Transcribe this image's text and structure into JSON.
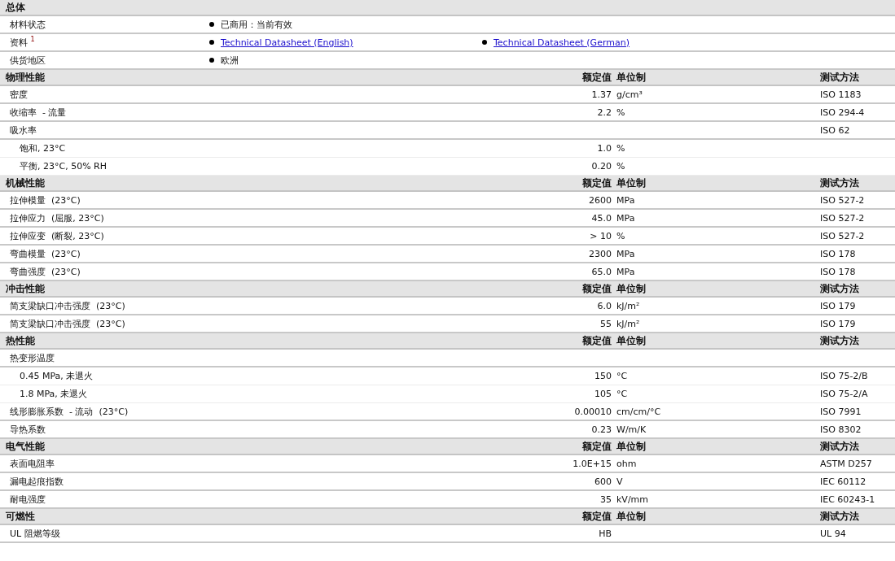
{
  "general": {
    "title": "总体",
    "rows": [
      {
        "label": "材料状态",
        "values": [
          {
            "text": "已商用：当前有效",
            "kind": "text"
          }
        ]
      },
      {
        "label": "资料 $^{1}$",
        "values": [
          {
            "text": "Technical Datasheet (English)",
            "kind": "link"
          },
          {
            "text": "Technical Datasheet (German)",
            "kind": "link"
          }
        ]
      },
      {
        "label": "供货地区",
        "values": [
          {
            "text": "欧洲",
            "kind": "text"
          }
        ]
      }
    ]
  },
  "sections": [
    {
      "title": "物理性能",
      "value_header": "额定值",
      "unit_header": "单位制",
      "method_header": "测试方法",
      "rows": [
        {
          "kind": "main",
          "label": "密度",
          "value": "1.37",
          "unit": "g/cm³",
          "method": "ISO 1183"
        },
        {
          "kind": "main",
          "label": "收缩率  - 流量",
          "value": "2.2",
          "unit": "%",
          "method": "ISO 294-4"
        },
        {
          "kind": "main",
          "label": "吸水率",
          "method": "ISO 62"
        },
        {
          "kind": "sub",
          "label": "饱和, 23°C",
          "value": "1.0",
          "unit": "%"
        },
        {
          "kind": "sub",
          "label": "平衡, 23°C, 50% RH",
          "value": "0.20",
          "unit": "%"
        }
      ]
    },
    {
      "title": "机械性能",
      "value_header": "额定值",
      "unit_header": "单位制",
      "method_header": "测试方法",
      "rows": [
        {
          "kind": "main",
          "label": "拉伸模量  (23°C)",
          "value": "2600",
          "unit": "MPa",
          "method": "ISO 527-2"
        },
        {
          "kind": "main",
          "label": "拉伸应力  (屈服, 23°C)",
          "value": "45.0",
          "unit": "MPa",
          "method": "ISO 527-2"
        },
        {
          "kind": "main",
          "label": "拉伸应变  (断裂, 23°C)",
          "value": "> 10",
          "unit": "%",
          "method": "ISO 527-2"
        },
        {
          "kind": "main",
          "label": "弯曲模量  (23°C)",
          "value": "2300",
          "unit": "MPa",
          "method": "ISO 178"
        },
        {
          "kind": "main",
          "label": "弯曲强度  (23°C)",
          "value": "65.0",
          "unit": "MPa",
          "method": "ISO 178"
        }
      ]
    },
    {
      "title": "冲击性能",
      "value_header": "额定值",
      "unit_header": "单位制",
      "method_header": "测试方法",
      "rows": [
        {
          "kind": "main",
          "label": "简支梁缺口冲击强度  (23°C)",
          "value": "6.0",
          "unit": "kJ/m²",
          "method": "ISO 179"
        },
        {
          "kind": "main",
          "label": "简支梁缺口冲击强度  (23°C)",
          "value": "55",
          "unit": "kJ/m²",
          "method": "ISO 179"
        }
      ]
    },
    {
      "title": "热性能",
      "value_header": "额定值",
      "unit_header": "单位制",
      "method_header": "测试方法",
      "rows": [
        {
          "kind": "main",
          "label": "热变形温度"
        },
        {
          "kind": "sub",
          "label": "0.45 MPa, 未退火",
          "value": "150",
          "unit": "°C",
          "method": "ISO 75-2/B"
        },
        {
          "kind": "sub",
          "label": "1.8 MPa, 未退火",
          "value": "105",
          "unit": "°C",
          "method": "ISO 75-2/A"
        },
        {
          "kind": "main",
          "label": "线形膨胀系数  - 流动  (23°C)",
          "value": "0.00010",
          "unit": "cm/cm/°C",
          "method": "ISO 7991"
        },
        {
          "kind": "main",
          "label": "导热系数",
          "value": "0.23",
          "unit": "W/m/K",
          "method": "ISO 8302"
        }
      ]
    },
    {
      "title": "电气性能",
      "value_header": "额定值",
      "unit_header": "单位制",
      "method_header": "测试方法",
      "rows": [
        {
          "kind": "main",
          "label": "表面电阻率",
          "value": "1.0E+15",
          "unit": "ohm",
          "method": "ASTM D257"
        },
        {
          "kind": "main",
          "label": "漏电起痕指数",
          "value": "600",
          "unit": "V",
          "method": "IEC 60112"
        },
        {
          "kind": "main",
          "label": "耐电强度",
          "value": "35",
          "unit": "kV/mm",
          "method": "IEC 60243-1"
        }
      ]
    },
    {
      "title": "可燃性",
      "value_header": "额定值",
      "unit_header": "单位制",
      "method_header": "测试方法",
      "rows": [
        {
          "kind": "main",
          "label": "UL 阻燃等级",
          "value": "HB",
          "method": "UL 94"
        }
      ]
    }
  ]
}
